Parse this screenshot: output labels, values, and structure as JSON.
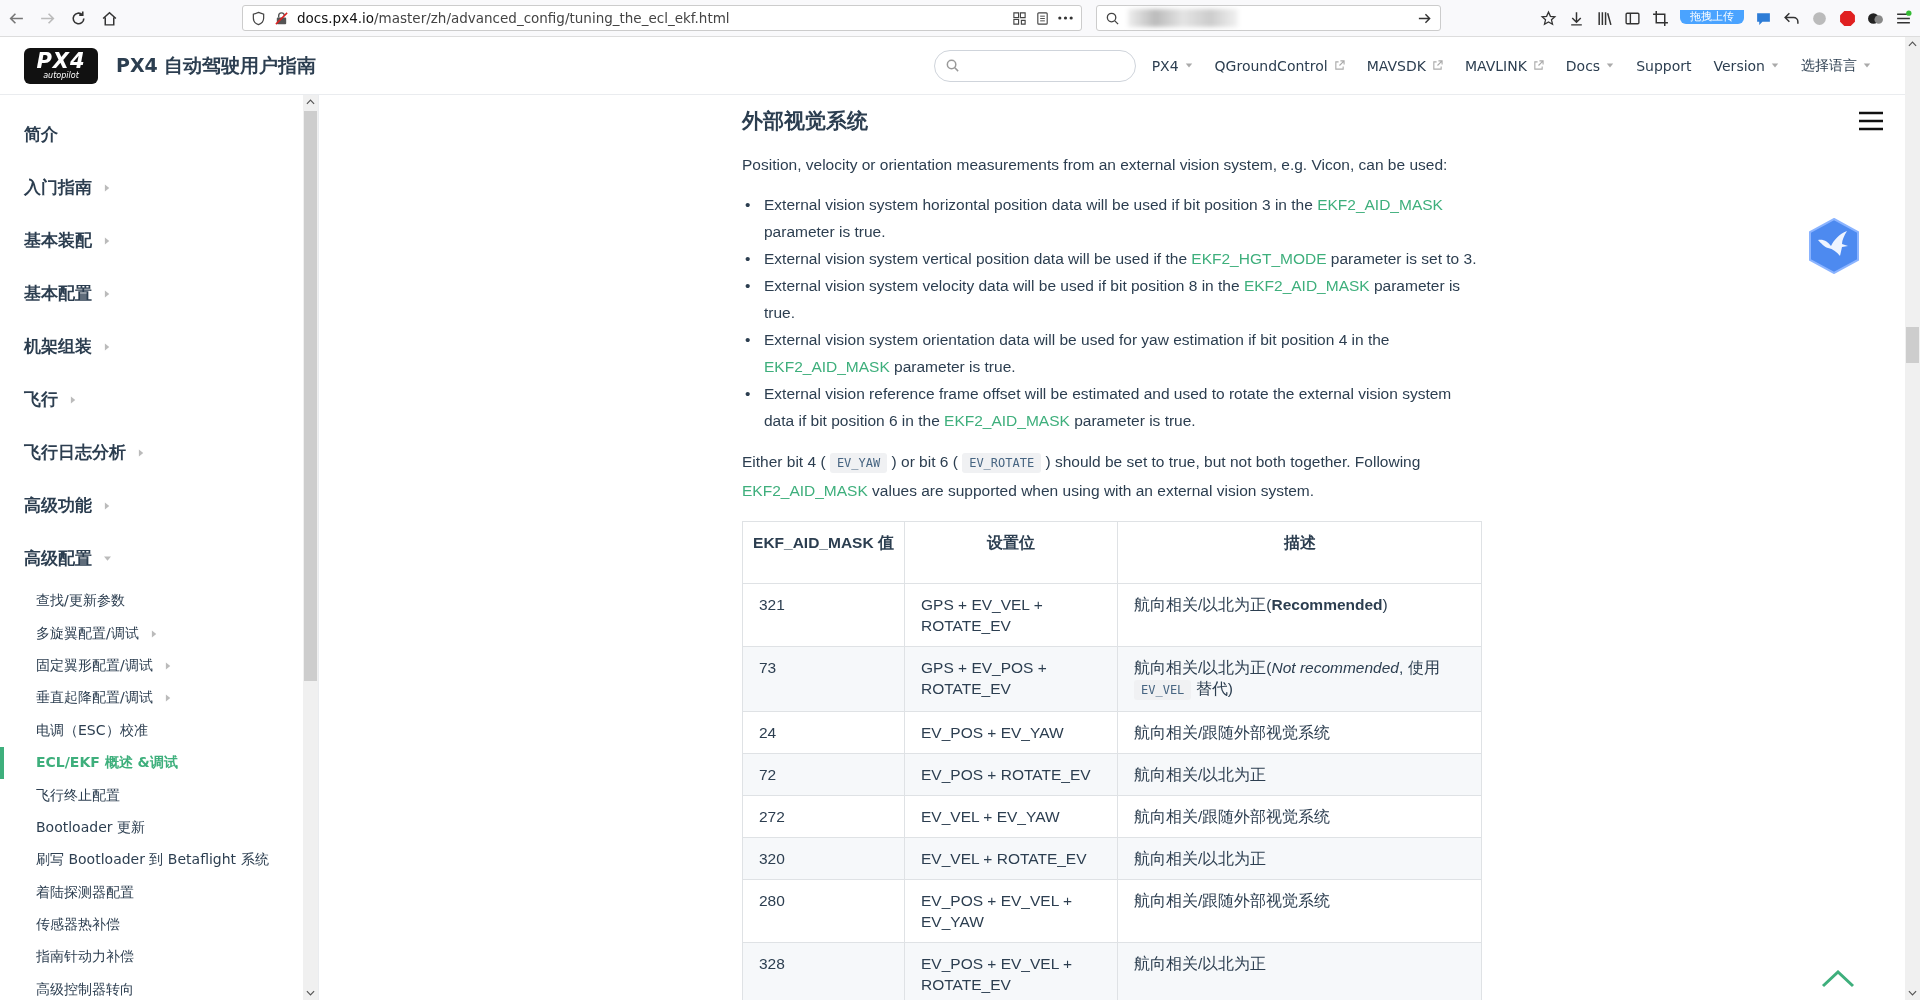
{
  "browser": {
    "url_host": "docs.px4.io",
    "url_path": "/master/zh/advanced_config/tuning_the_ecl_ekf.html",
    "badge": "拖拽上传"
  },
  "header": {
    "logo": {
      "main": "PX4",
      "sub": "autopilot"
    },
    "title": "PX4 自动驾驶用户指南",
    "nav": [
      {
        "label": "PX4",
        "kind": "dropdown"
      },
      {
        "label": "QGroundControl",
        "kind": "external"
      },
      {
        "label": "MAVSDK",
        "kind": "external"
      },
      {
        "label": "MAVLINK",
        "kind": "external"
      },
      {
        "label": "Docs",
        "kind": "dropdown"
      },
      {
        "label": "Support",
        "kind": "plain"
      },
      {
        "label": "Version",
        "kind": "dropdown"
      },
      {
        "label": "选择语言",
        "kind": "dropdown"
      }
    ]
  },
  "sidebar": {
    "items": [
      {
        "label": "简介",
        "kind": "page",
        "selected": false
      },
      {
        "label": "入门指南",
        "kind": "folder",
        "expanded": false,
        "selected": false
      },
      {
        "label": "基本装配",
        "kind": "folder",
        "expanded": false,
        "selected": false
      },
      {
        "label": "基本配置",
        "kind": "folder",
        "expanded": false,
        "selected": false
      },
      {
        "label": "机架组装",
        "kind": "folder",
        "expanded": false,
        "selected": false
      },
      {
        "label": "飞行",
        "kind": "folder",
        "expanded": false,
        "selected": false
      },
      {
        "label": "飞行日志分析",
        "kind": "folder",
        "expanded": false,
        "selected": false
      },
      {
        "label": "高级功能",
        "kind": "folder",
        "expanded": false,
        "selected": false
      },
      {
        "label": "高级配置",
        "kind": "folder",
        "expanded": true,
        "selected": false,
        "children": [
          {
            "label": "查找/更新参数",
            "kind": "page",
            "selected": false
          },
          {
            "label": "多旋翼配置/调试",
            "kind": "folder",
            "expanded": false,
            "selected": false
          },
          {
            "label": "固定翼形配置/调试",
            "kind": "folder",
            "expanded": false,
            "selected": false
          },
          {
            "label": "垂直起降配置/调试",
            "kind": "folder",
            "expanded": false,
            "selected": false
          },
          {
            "label": "电调（ESC）校准",
            "kind": "page",
            "selected": false
          },
          {
            "label": "ECL/EKF 概述 &调试",
            "kind": "page",
            "selected": true
          },
          {
            "label": "飞行终止配置",
            "kind": "page",
            "selected": false
          },
          {
            "label": "Bootloader 更新",
            "kind": "page",
            "selected": false
          },
          {
            "label": "刷写 Bootloader 到 Betaflight 系统",
            "kind": "page",
            "selected": false
          },
          {
            "label": "着陆探测器配置",
            "kind": "page",
            "selected": false
          },
          {
            "label": "传感器热补偿",
            "kind": "page",
            "selected": false
          },
          {
            "label": "指南针动力补偿",
            "kind": "page",
            "selected": false
          },
          {
            "label": "高级控制器转向",
            "kind": "page",
            "selected": false
          }
        ]
      }
    ]
  },
  "content": {
    "heading": "外部视觉系统",
    "bullet_marker": "•",
    "intro": "Position, velocity or orientation measurements from an external vision system, e.g. Vicon, can be used:",
    "bullets": [
      [
        {
          "kind": "text",
          "text": "External vision system horizontal position data will be used if bit position 3 in the "
        },
        {
          "kind": "link",
          "text": "EKF2_AID_MASK"
        },
        {
          "kind": "text",
          "text": " parameter is true."
        }
      ],
      [
        {
          "kind": "text",
          "text": "External vision system vertical position data will be used if the "
        },
        {
          "kind": "link",
          "text": "EKF2_HGT_MODE"
        },
        {
          "kind": "text",
          "text": " parameter is set to 3."
        }
      ],
      [
        {
          "kind": "text",
          "text": "External vision system velocity data will be used if bit position 8 in the "
        },
        {
          "kind": "link",
          "text": "EKF2_AID_MASK"
        },
        {
          "kind": "text",
          "text": " parameter is true."
        }
      ],
      [
        {
          "kind": "text",
          "text": "External vision system orientation data will be used for yaw estimation if bit position 4 in the "
        },
        {
          "kind": "link",
          "text": "EKF2_AID_MASK"
        },
        {
          "kind": "text",
          "text": " parameter is true."
        }
      ],
      [
        {
          "kind": "text",
          "text": "External vision reference frame offset will be estimated and used to rotate the external vision system data if bit position 6 in the "
        },
        {
          "kind": "link",
          "text": "EKF2_AID_MASK"
        },
        {
          "kind": "text",
          "text": " parameter is true."
        }
      ]
    ],
    "note": [
      {
        "kind": "text",
        "text": "Either bit 4 ( "
      },
      {
        "kind": "code",
        "text": "EV_YAW"
      },
      {
        "kind": "text",
        "text": " ) or bit 6 ( "
      },
      {
        "kind": "code",
        "text": "EV_ROTATE"
      },
      {
        "kind": "text",
        "text": " ) should be set to true, but not both together. Following "
      },
      {
        "kind": "link",
        "text": "EKF2_AID_MASK"
      },
      {
        "kind": "text",
        "text": " values are supported when using with an external vision system."
      }
    ],
    "table": {
      "columns": [
        "EKF_AID_MASK 值",
        "设置位",
        "描述"
      ],
      "rows": [
        [
          "321",
          "GPS + EV_VEL + ROTATE_EV",
          [
            {
              "kind": "text",
              "text": "航向相关/以北为正(**Recommended**)"
            }
          ]
        ],
        [
          "73",
          "GPS + EV_POS + ROTATE_EV",
          [
            {
              "kind": "text",
              "text": "航向相关/以北为正(*Not recommended*, 使用 "
            },
            {
              "kind": "code",
              "text": "EV_VEL"
            },
            {
              "kind": "text",
              "text": " 替代)"
            }
          ]
        ],
        [
          "24",
          "EV_POS + EV_YAW",
          [
            {
              "kind": "text",
              "text": "航向相关/跟随外部视觉系统"
            }
          ]
        ],
        [
          "72",
          "EV_POS + ROTATE_EV",
          [
            {
              "kind": "text",
              "text": "航向相关/以北为正"
            }
          ]
        ],
        [
          "272",
          "EV_VEL + EV_YAW",
          [
            {
              "kind": "text",
              "text": "航向相关/跟随外部视觉系统"
            }
          ]
        ],
        [
          "320",
          "EV_VEL + ROTATE_EV",
          [
            {
              "kind": "text",
              "text": "航向相关/以北为正"
            }
          ]
        ],
        [
          "280",
          "EV_POS + EV_VEL + EV_YAW",
          [
            {
              "kind": "text",
              "text": "航向相关/跟随外部视觉系统"
            }
          ]
        ],
        [
          "328",
          "EV_POS + EV_VEL + ROTATE_EV",
          [
            {
              "kind": "text",
              "text": "航向相关/以北为正"
            }
          ]
        ]
      ]
    }
  }
}
